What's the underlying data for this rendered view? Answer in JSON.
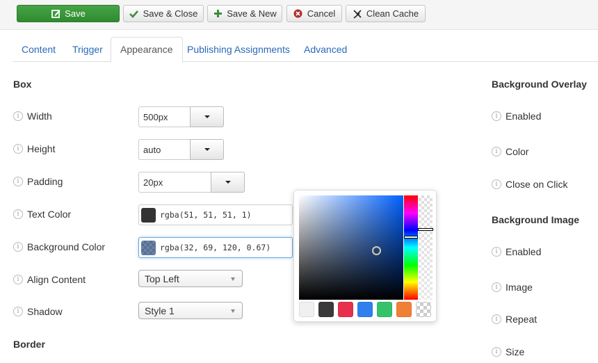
{
  "toolbar": {
    "buttons": [
      {
        "label": "Save",
        "icon": "edit-icon"
      },
      {
        "label": "Save & Close",
        "icon": "checkmark-icon"
      },
      {
        "label": "Save & New",
        "icon": "plus-icon"
      },
      {
        "label": "Cancel",
        "icon": "cancel-circle-icon"
      },
      {
        "label": "Clean Cache",
        "icon": "lightning-icon"
      }
    ]
  },
  "tabs": [
    {
      "label": "Content",
      "active": false
    },
    {
      "label": "Trigger",
      "active": false
    },
    {
      "label": "Appearance",
      "active": true
    },
    {
      "label": "Publishing Assignments",
      "active": false
    },
    {
      "label": "Advanced",
      "active": false
    }
  ],
  "box": {
    "title": "Box",
    "width": {
      "label": "Width",
      "value": "500px"
    },
    "height": {
      "label": "Height",
      "value": "auto"
    },
    "padding": {
      "label": "Padding",
      "value": "20px"
    },
    "text_color": {
      "label": "Text Color",
      "value": "rgba(51, 51, 51, 1)",
      "swatch": "#333333"
    },
    "background_color": {
      "label": "Background Color",
      "value": "rgba(32, 69, 120, 0.67)",
      "swatch": "rgba(32,69,120,0.67)"
    },
    "align_content": {
      "label": "Align Content",
      "value": "Top Left"
    },
    "shadow": {
      "label": "Shadow",
      "value": "Style 1"
    }
  },
  "border": {
    "title": "Border"
  },
  "background_overlay": {
    "title": "Background Overlay",
    "fields": [
      "Enabled",
      "Color",
      "Close on Click"
    ]
  },
  "background_image": {
    "title": "Background Image",
    "fields": [
      "Enabled",
      "Image",
      "Repeat",
      "Size"
    ]
  },
  "color_picker": {
    "hue_color": "#0061ff",
    "alpha": 0.67,
    "presets": [
      "#f0f0f0",
      "#3a3a3a",
      "#e8304c",
      "#2f80ed",
      "#34c36b",
      "#f08036",
      "transparent"
    ]
  }
}
